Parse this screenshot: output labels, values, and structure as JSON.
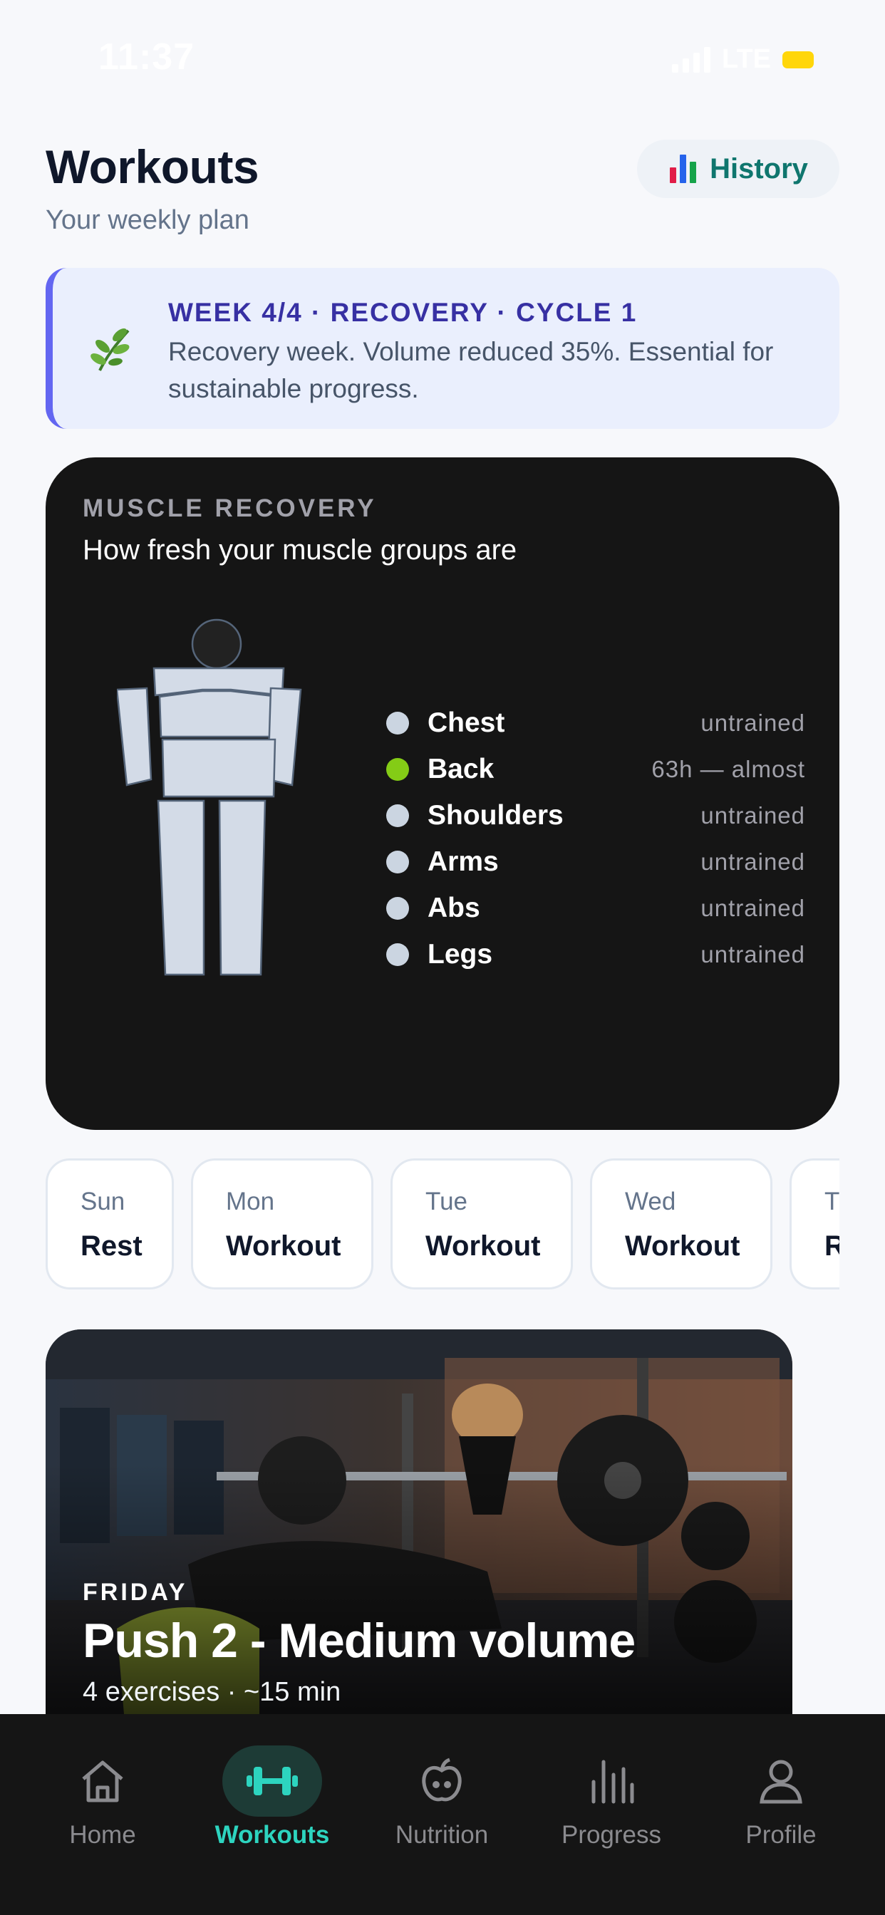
{
  "status_bar": {
    "time": "11:37",
    "network": "LTE"
  },
  "header": {
    "title": "Workouts",
    "subtitle": "Your weekly plan",
    "history_label": "History",
    "history_icon": "bar-chart-icon"
  },
  "banner": {
    "icon": "herb-leaf-icon",
    "title": "WEEK 4/4 · RECOVERY · CYCLE 1",
    "text": "Recovery week. Volume reduced 35%. Essential for sustainable progress.",
    "accent_color": "#6366f1"
  },
  "recovery": {
    "label": "MUSCLE RECOVERY",
    "subtitle": "How fresh your muscle groups are",
    "muscles": [
      {
        "name": "Chest",
        "status": "untrained",
        "color": "#cbd5e1"
      },
      {
        "name": "Back",
        "status": "63h — almost",
        "color": "#84cc16"
      },
      {
        "name": "Shoulders",
        "status": "untrained",
        "color": "#cbd5e1"
      },
      {
        "name": "Arms",
        "status": "untrained",
        "color": "#cbd5e1"
      },
      {
        "name": "Abs",
        "status": "untrained",
        "color": "#cbd5e1"
      },
      {
        "name": "Legs",
        "status": "untrained",
        "color": "#cbd5e1"
      }
    ]
  },
  "days": [
    {
      "name": "Sun",
      "type": "Rest"
    },
    {
      "name": "Mon",
      "type": "Workout"
    },
    {
      "name": "Tue",
      "type": "Workout"
    },
    {
      "name": "Wed",
      "type": "Workout"
    },
    {
      "name": "Th",
      "type": "R"
    }
  ],
  "workout_card": {
    "day": "FRIDAY",
    "title": "Push 2 - Medium volume",
    "meta": "4 exercises · ~15 min"
  },
  "tabs": [
    {
      "label": "Home",
      "icon": "home-icon",
      "active": false
    },
    {
      "label": "Workouts",
      "icon": "dumbbell-icon",
      "active": true
    },
    {
      "label": "Nutrition",
      "icon": "apple-icon",
      "active": false
    },
    {
      "label": "Progress",
      "icon": "bar-chart-icon",
      "active": false
    },
    {
      "label": "Profile",
      "icon": "user-icon",
      "active": false
    }
  ],
  "colors": {
    "accent": "#2dd4bf",
    "history_text": "#0f766e",
    "banner_title": "#3730a3",
    "card_dark": "#151515"
  }
}
